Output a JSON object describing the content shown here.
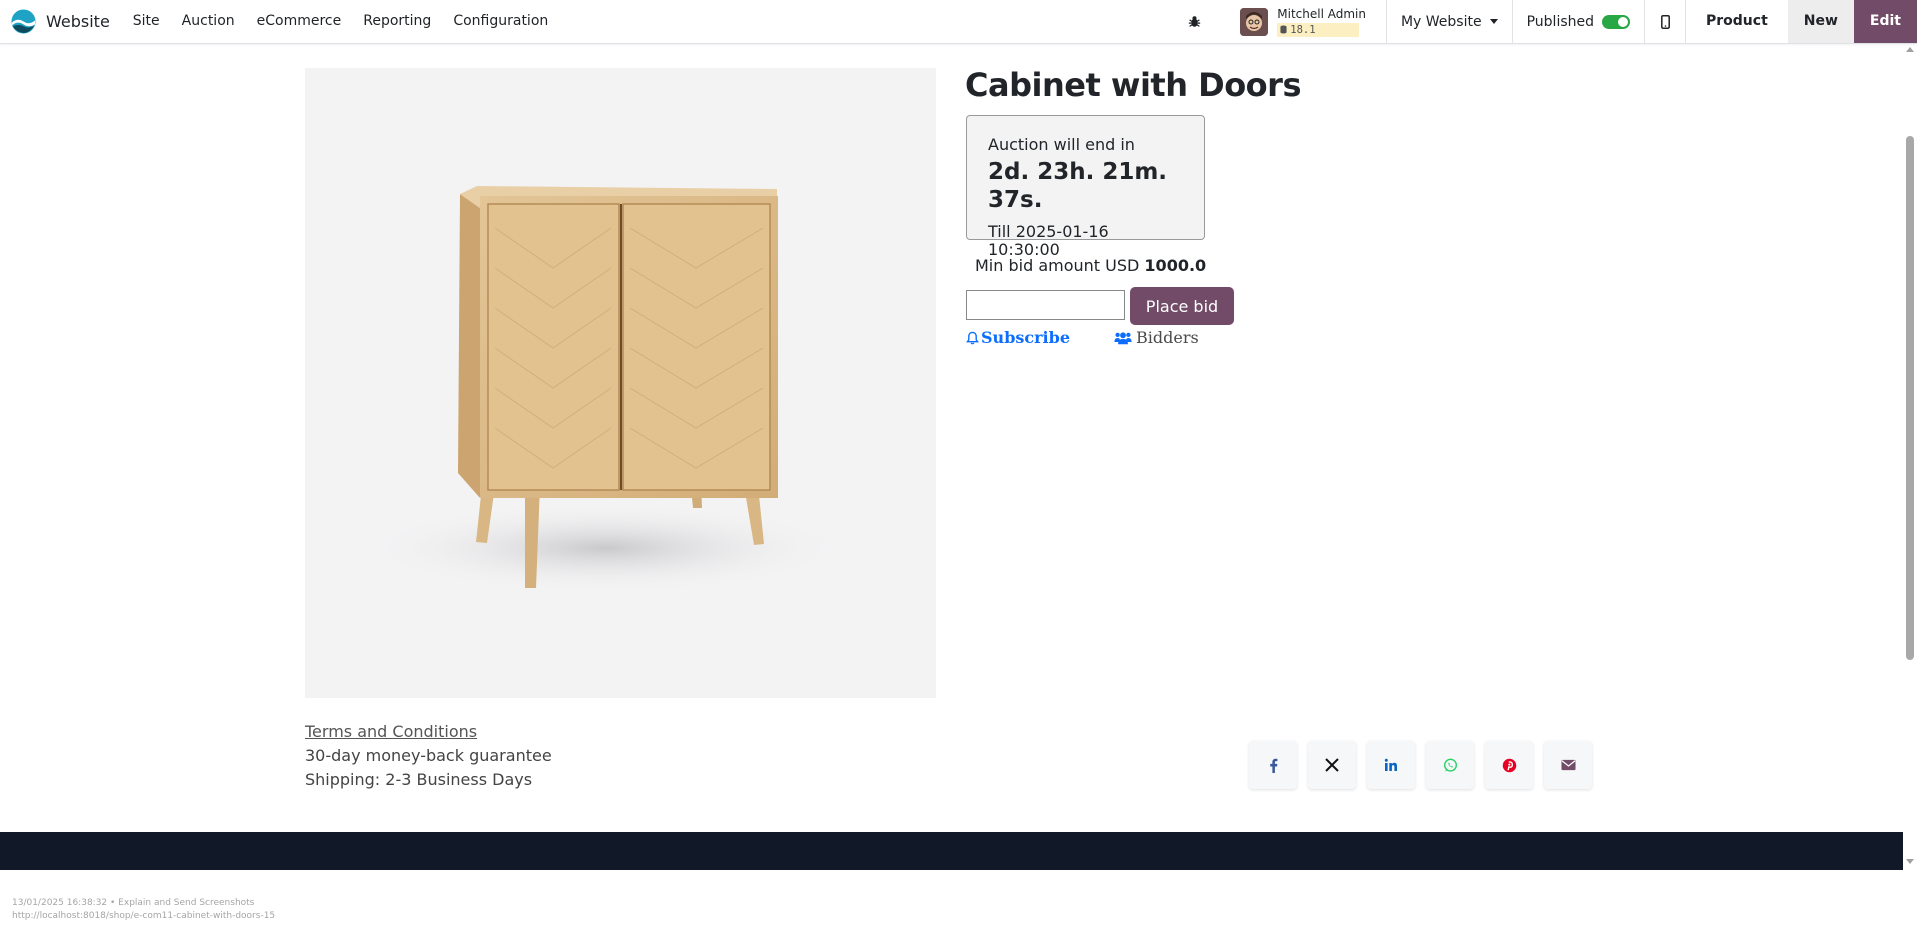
{
  "navbar": {
    "brand": "Website",
    "menu": [
      "Site",
      "Auction",
      "eCommerce",
      "Reporting",
      "Configuration"
    ],
    "user_name": "Mitchell Admin",
    "db_version": "18.1",
    "website_selector": "My Website",
    "published_label": "Published",
    "published_on": true,
    "product_button": "Product",
    "new_button": "New",
    "edit_button": "Edit"
  },
  "product": {
    "title": "Cabinet with Doors",
    "auction_end_label": "Auction will end in",
    "countdown": "2d. 23h. 21m. 37s.",
    "till": "Till 2025-01-16 10:30:00",
    "min_bid_label": "Min bid amount USD",
    "min_bid_value": "1000.0",
    "bid_input_value": "",
    "place_bid": "Place bid",
    "subscribe": "Subscribe",
    "bidders": "Bidders"
  },
  "info": {
    "terms": "Terms and Conditions",
    "guarantee": "30-day money-back guarantee",
    "shipping": "Shipping: 2-3 Business Days"
  },
  "share_icons": [
    "facebook-icon",
    "x-twitter-icon",
    "linkedin-icon",
    "whatsapp-icon",
    "pinterest-icon",
    "envelope-icon"
  ],
  "colors": {
    "brand_purple": "#714b67",
    "link_blue": "#0d6efd",
    "footer_dark": "#111827",
    "toggle_green": "#28a745"
  },
  "status_bar": {
    "line1": "13/01/2025 16:38:32 • Explain and Send Screenshots",
    "line2": "http://localhost:8018/shop/e-com11-cabinet-with-doors-15"
  }
}
